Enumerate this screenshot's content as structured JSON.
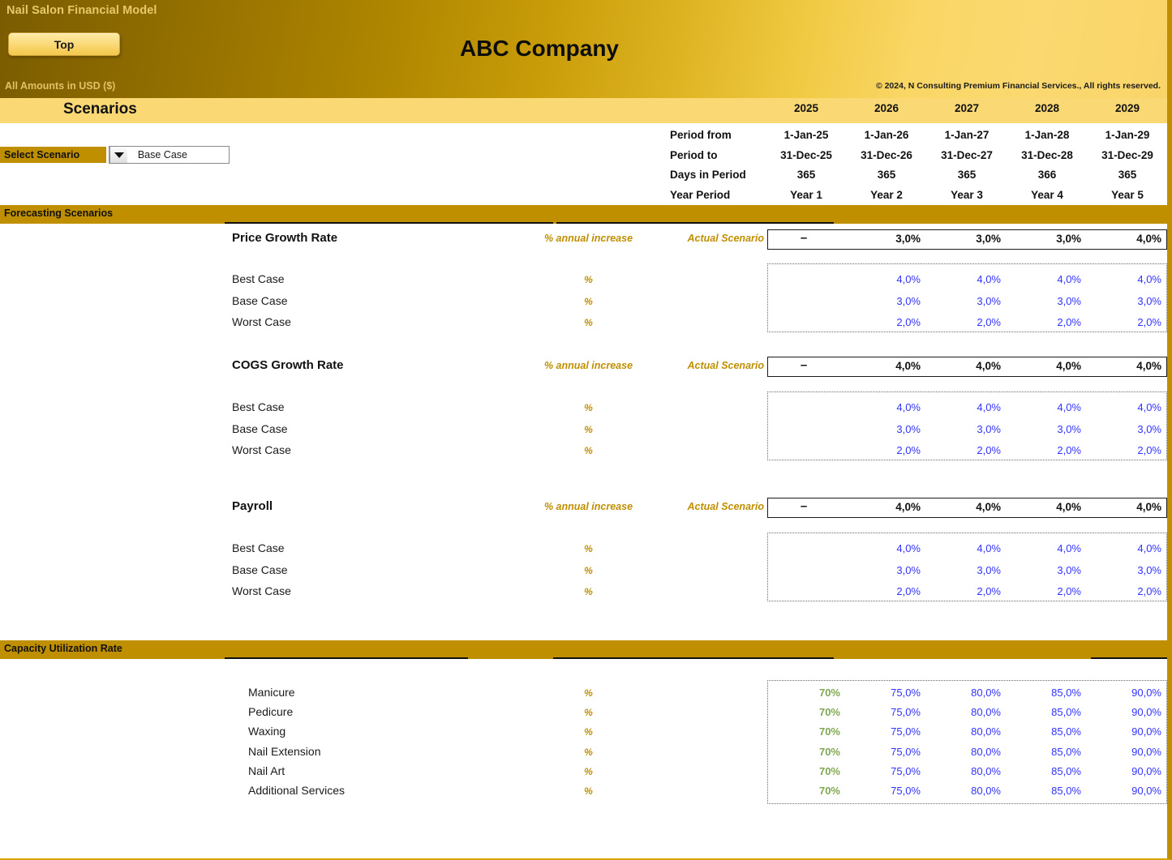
{
  "header": {
    "model_title": "Nail Salon Financial Model",
    "top_button": "Top",
    "company_name": "ABC Company",
    "amounts_note": "All Amounts in  USD ($)",
    "copyright": "© 2024, N Consulting Premium Financial Services., All rights reserved."
  },
  "scenarios_panel": {
    "title": "Scenarios",
    "select_label": "Select Scenario",
    "selected_scenario": "Base Case",
    "scenario_options": [
      "Best Case",
      "Base Case",
      "Worst Case"
    ]
  },
  "columns": {
    "years": [
      "2025",
      "2026",
      "2027",
      "2028",
      "2029"
    ]
  },
  "period_table": {
    "rows": [
      {
        "label": "Period from",
        "values": [
          "1-Jan-25",
          "1-Jan-26",
          "1-Jan-27",
          "1-Jan-28",
          "1-Jan-29"
        ]
      },
      {
        "label": "Period to",
        "values": [
          "31-Dec-25",
          "31-Dec-26",
          "31-Dec-27",
          "31-Dec-28",
          "31-Dec-29"
        ]
      },
      {
        "label": "Days in Period",
        "values": [
          "365",
          "365",
          "365",
          "366",
          "365"
        ]
      },
      {
        "label": "Year Period",
        "values": [
          "Year 1",
          "Year 2",
          "Year 3",
          "Year 4",
          "Year 5"
        ]
      }
    ]
  },
  "sections": {
    "forecasting": {
      "bar_label": "Forecasting Scenarios",
      "actual_tag": "Actual Scenario",
      "groups": [
        {
          "title": "Price Growth Rate",
          "unit": "% annual increase",
          "case_unit": "%",
          "actual": [
            "–",
            "3,0%",
            "3,0%",
            "3,0%",
            "4,0%"
          ],
          "cases": [
            {
              "label": "Best Case",
              "values": [
                "",
                "4,0%",
                "4,0%",
                "4,0%",
                "4,0%"
              ]
            },
            {
              "label": "Base Case",
              "values": [
                "",
                "3,0%",
                "3,0%",
                "3,0%",
                "3,0%"
              ]
            },
            {
              "label": "Worst Case",
              "values": [
                "",
                "2,0%",
                "2,0%",
                "2,0%",
                "2,0%"
              ]
            }
          ]
        },
        {
          "title": "COGS Growth Rate",
          "unit": "% annual increase",
          "case_unit": "%",
          "actual": [
            "–",
            "4,0%",
            "4,0%",
            "4,0%",
            "4,0%"
          ],
          "cases": [
            {
              "label": "Best Case",
              "values": [
                "",
                "4,0%",
                "4,0%",
                "4,0%",
                "4,0%"
              ]
            },
            {
              "label": "Base Case",
              "values": [
                "",
                "3,0%",
                "3,0%",
                "3,0%",
                "3,0%"
              ]
            },
            {
              "label": "Worst Case",
              "values": [
                "",
                "2,0%",
                "2,0%",
                "2,0%",
                "2,0%"
              ]
            }
          ]
        },
        {
          "title": "Payroll",
          "unit": "% annual increase",
          "case_unit": "%",
          "actual": [
            "–",
            "4,0%",
            "4,0%",
            "4,0%",
            "4,0%"
          ],
          "cases": [
            {
              "label": "Best Case",
              "values": [
                "",
                "4,0%",
                "4,0%",
                "4,0%",
                "4,0%"
              ]
            },
            {
              "label": "Base Case",
              "values": [
                "",
                "3,0%",
                "3,0%",
                "3,0%",
                "3,0%"
              ]
            },
            {
              "label": "Worst Case",
              "values": [
                "",
                "2,0%",
                "2,0%",
                "2,0%",
                "2,0%"
              ]
            }
          ]
        }
      ]
    },
    "capacity": {
      "bar_label": "Capacity Utilization Rate",
      "unit": "%",
      "rows": [
        {
          "label": "Manicure",
          "values": [
            "70%",
            "75,0%",
            "80,0%",
            "85,0%",
            "90,0%"
          ]
        },
        {
          "label": "Pedicure",
          "values": [
            "70%",
            "75,0%",
            "80,0%",
            "85,0%",
            "90,0%"
          ]
        },
        {
          "label": "Waxing",
          "values": [
            "70%",
            "75,0%",
            "80,0%",
            "85,0%",
            "90,0%"
          ]
        },
        {
          "label": "Nail Extension",
          "values": [
            "70%",
            "75,0%",
            "80,0%",
            "85,0%",
            "90,0%"
          ]
        },
        {
          "label": "Nail Art",
          "values": [
            "70%",
            "75,0%",
            "80,0%",
            "85,0%",
            "90,0%"
          ]
        },
        {
          "label": "Additional Services",
          "values": [
            "70%",
            "75,0%",
            "80,0%",
            "85,0%",
            "90,0%"
          ]
        }
      ]
    }
  },
  "colors": {
    "gold_dark": "#bf8f00",
    "gold_light": "#fad975",
    "input_blue": "#3333ff",
    "hardcode_green": "#7fa84f",
    "text_dark": "#111111"
  }
}
